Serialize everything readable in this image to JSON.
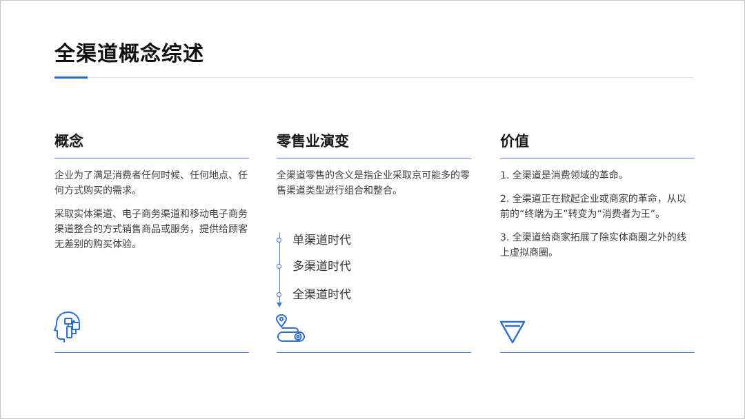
{
  "page": {
    "title": "全渠道概念综述"
  },
  "theme": {
    "accent": "#1f6fd1",
    "rule": "#4f86d2",
    "icon": "#2f6fcf"
  },
  "columns": [
    {
      "heading": "概念",
      "paragraphs": [
        "企业为了满足消费者任何时候、任何地点、任何方式购买的需求。",
        "采取实体渠道、电子商务渠道和移动电子商务渠道整合的方式销售商品或服务，提供给顾客无差别的购买体验。"
      ],
      "icon": "head-brain-icon"
    },
    {
      "heading": "零售业演变",
      "paragraphs": [
        "全渠道零售的含义是指企业采取京可能多的零售渠道类型进行组合和整合。"
      ],
      "timeline": [
        "单渠道时代",
        "多渠道时代",
        "全渠道时代"
      ],
      "icon": "route-pin-icon"
    },
    {
      "heading": "价值",
      "paragraphs": [
        "1. 全渠道是消费领域的革命。",
        "2. 全渠道正在掀起企业或商家的革命，从以前的“终端为王”转变为“消费者为王”。",
        "3. 全渠道给商家拓展了除实体商圈之外的线上虚拟商圈。"
      ],
      "icon": "diamond-icon"
    }
  ]
}
